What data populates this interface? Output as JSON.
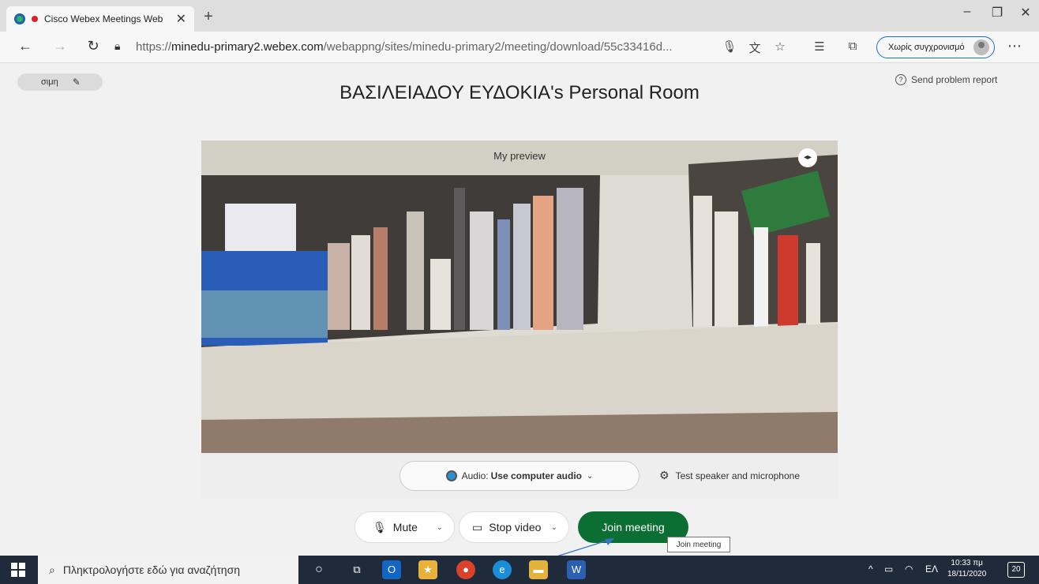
{
  "browser": {
    "tab_title": "Cisco Webex Meetings Web",
    "new_tab": "+",
    "url_prefix": "https://",
    "url_host": "minedu-primary2.webex.com",
    "url_path": "/webappng/sites/minedu-primary2/meeting/download/55c33416d...",
    "sync_label": "Χωρίς συγχρονισμό",
    "window_controls": [
      "–",
      "❐",
      "✕"
    ]
  },
  "page": {
    "user_name": "σιμη",
    "room_title": "ΒΑΣΙΛΕΙΑΔΟΥ ΕΥΔΟΚΙΑ's Personal Room",
    "send_report": "Send problem report",
    "preview_label": "My preview",
    "audio_prefix": "Audio:",
    "audio_value": "Use computer audio",
    "test_speaker": "Test speaker and microphone",
    "mute_label": "Mute",
    "stop_video_label": "Stop video",
    "join_label": "Join meeting",
    "join_tooltip": "Join meeting",
    "join_color": "#0b6e32"
  },
  "taskbar": {
    "search_placeholder": "Πληκτρολογήστε εδώ για αναζήτηση",
    "language": "ΕΛ",
    "time": "10:33 πμ",
    "date": "18/11/2020",
    "notifications": "20"
  }
}
